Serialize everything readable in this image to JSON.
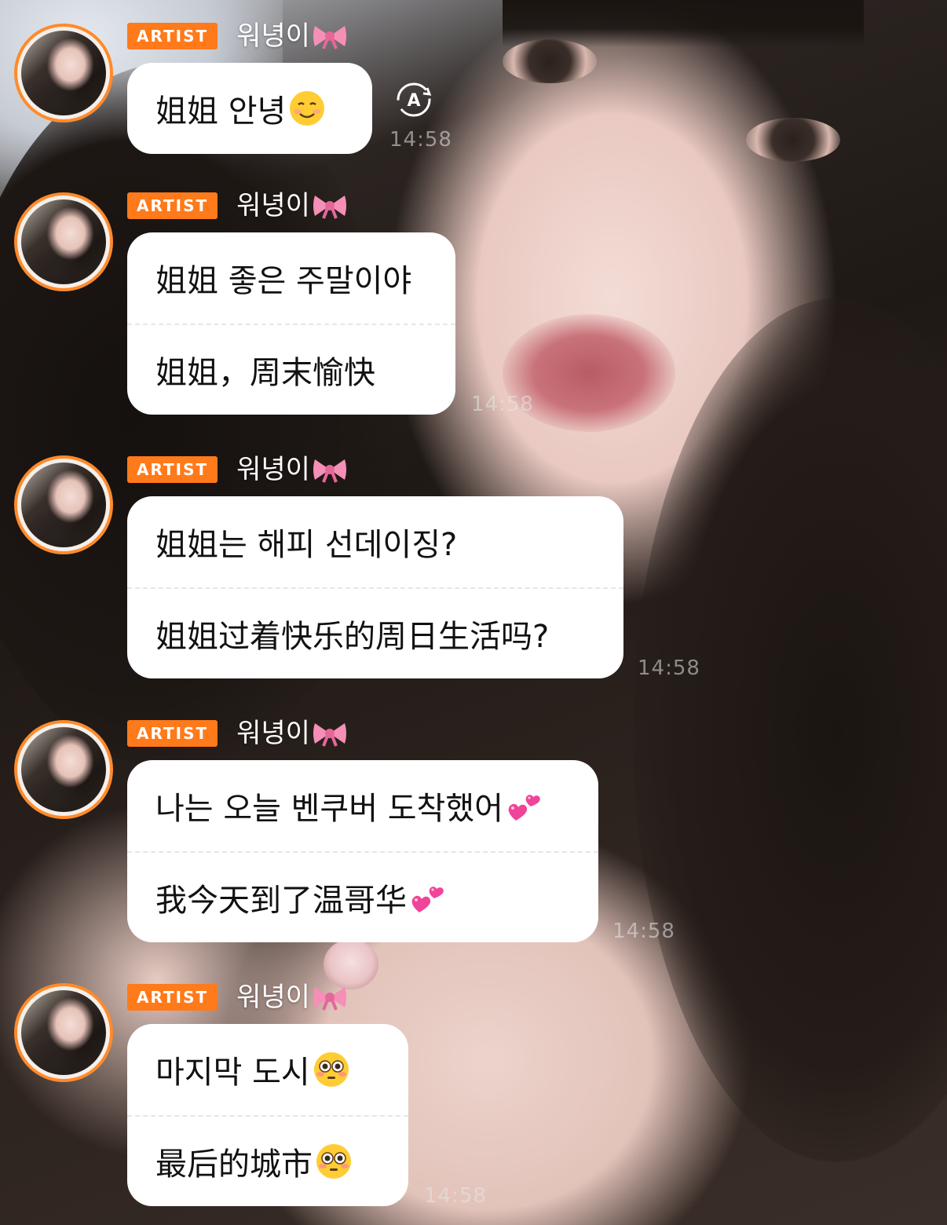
{
  "artist_label": "ARTIST",
  "username": "워녕이",
  "messages": [
    {
      "lines": [
        "姐姐 안녕"
      ],
      "time": "14:58",
      "emojis": [
        "smiling-face-icon"
      ]
    },
    {
      "lines": [
        "姐姐 좋은 주말이야",
        "姐姐，周末愉快"
      ],
      "time": "14:58",
      "emojis": []
    },
    {
      "lines": [
        "姐姐는 해피 선데이징?",
        "姐姐过着快乐的周日生活吗?"
      ],
      "time": "14:58",
      "emojis": []
    },
    {
      "lines": [
        "나는 오늘 벤쿠버 도착했어",
        "我今天到了温哥华"
      ],
      "time": "14:58",
      "emojis": [
        "two-hearts-icon",
        "two-hearts-icon"
      ]
    },
    {
      "lines": [
        "마지막 도시",
        "最后的城市"
      ],
      "time": "14:58",
      "emojis": [
        "flushed-face-icon",
        "flushed-face-icon"
      ]
    }
  ],
  "colors": {
    "badge": "#ff7a1a",
    "avatar_ring": "#ff8a2b",
    "bubble": "#ffffff"
  }
}
